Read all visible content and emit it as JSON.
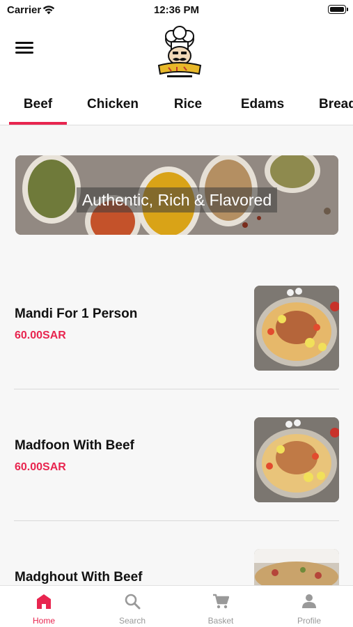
{
  "status_bar": {
    "carrier": "Carrier",
    "time": "12:36 PM"
  },
  "header": {
    "menu_icon": "hamburger-menu-icon",
    "logo_icon": "chef-logo-icon"
  },
  "tabs": [
    {
      "label": "Beef",
      "active": true
    },
    {
      "label": "Chicken",
      "active": false
    },
    {
      "label": "Rice",
      "active": false
    },
    {
      "label": "Edams",
      "active": false
    },
    {
      "label": "Bread",
      "active": false
    }
  ],
  "banner": {
    "caption": "Authentic, Rich & Flavored"
  },
  "products": [
    {
      "name": "Mandi For 1 Person",
      "price": "60.00SAR"
    },
    {
      "name": "Madfoon With Beef",
      "price": "60.00SAR"
    },
    {
      "name": "Madghout With Beef",
      "price": ""
    }
  ],
  "bottom_nav": [
    {
      "label": "Home",
      "icon": "home-icon",
      "active": true
    },
    {
      "label": "Search",
      "icon": "search-icon",
      "active": false
    },
    {
      "label": "Basket",
      "icon": "cart-icon",
      "active": false
    },
    {
      "label": "Profile",
      "icon": "profile-icon",
      "active": false
    }
  ],
  "colors": {
    "accent": "#e8254f",
    "inactive": "#999999",
    "background": "#f7f7f7"
  }
}
